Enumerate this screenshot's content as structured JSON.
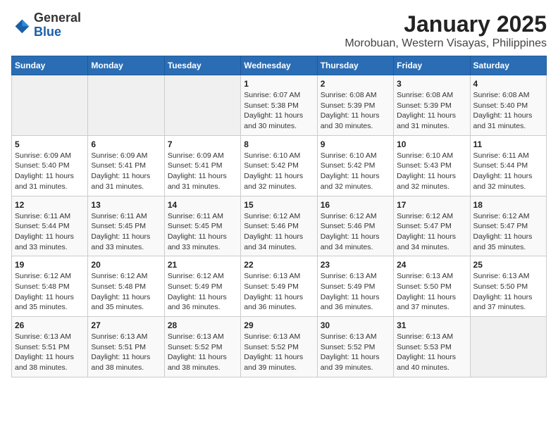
{
  "header": {
    "logo": {
      "line1": "General",
      "line2": "Blue"
    },
    "title": "January 2025",
    "subtitle": "Morobuan, Western Visayas, Philippines"
  },
  "weekdays": [
    "Sunday",
    "Monday",
    "Tuesday",
    "Wednesday",
    "Thursday",
    "Friday",
    "Saturday"
  ],
  "weeks": [
    [
      {
        "day": "",
        "info": ""
      },
      {
        "day": "",
        "info": ""
      },
      {
        "day": "",
        "info": ""
      },
      {
        "day": "1",
        "info": "Sunrise: 6:07 AM\nSunset: 5:38 PM\nDaylight: 11 hours\nand 30 minutes."
      },
      {
        "day": "2",
        "info": "Sunrise: 6:08 AM\nSunset: 5:39 PM\nDaylight: 11 hours\nand 30 minutes."
      },
      {
        "day": "3",
        "info": "Sunrise: 6:08 AM\nSunset: 5:39 PM\nDaylight: 11 hours\nand 31 minutes."
      },
      {
        "day": "4",
        "info": "Sunrise: 6:08 AM\nSunset: 5:40 PM\nDaylight: 11 hours\nand 31 minutes."
      }
    ],
    [
      {
        "day": "5",
        "info": "Sunrise: 6:09 AM\nSunset: 5:40 PM\nDaylight: 11 hours\nand 31 minutes."
      },
      {
        "day": "6",
        "info": "Sunrise: 6:09 AM\nSunset: 5:41 PM\nDaylight: 11 hours\nand 31 minutes."
      },
      {
        "day": "7",
        "info": "Sunrise: 6:09 AM\nSunset: 5:41 PM\nDaylight: 11 hours\nand 31 minutes."
      },
      {
        "day": "8",
        "info": "Sunrise: 6:10 AM\nSunset: 5:42 PM\nDaylight: 11 hours\nand 32 minutes."
      },
      {
        "day": "9",
        "info": "Sunrise: 6:10 AM\nSunset: 5:42 PM\nDaylight: 11 hours\nand 32 minutes."
      },
      {
        "day": "10",
        "info": "Sunrise: 6:10 AM\nSunset: 5:43 PM\nDaylight: 11 hours\nand 32 minutes."
      },
      {
        "day": "11",
        "info": "Sunrise: 6:11 AM\nSunset: 5:44 PM\nDaylight: 11 hours\nand 32 minutes."
      }
    ],
    [
      {
        "day": "12",
        "info": "Sunrise: 6:11 AM\nSunset: 5:44 PM\nDaylight: 11 hours\nand 33 minutes."
      },
      {
        "day": "13",
        "info": "Sunrise: 6:11 AM\nSunset: 5:45 PM\nDaylight: 11 hours\nand 33 minutes."
      },
      {
        "day": "14",
        "info": "Sunrise: 6:11 AM\nSunset: 5:45 PM\nDaylight: 11 hours\nand 33 minutes."
      },
      {
        "day": "15",
        "info": "Sunrise: 6:12 AM\nSunset: 5:46 PM\nDaylight: 11 hours\nand 34 minutes."
      },
      {
        "day": "16",
        "info": "Sunrise: 6:12 AM\nSunset: 5:46 PM\nDaylight: 11 hours\nand 34 minutes."
      },
      {
        "day": "17",
        "info": "Sunrise: 6:12 AM\nSunset: 5:47 PM\nDaylight: 11 hours\nand 34 minutes."
      },
      {
        "day": "18",
        "info": "Sunrise: 6:12 AM\nSunset: 5:47 PM\nDaylight: 11 hours\nand 35 minutes."
      }
    ],
    [
      {
        "day": "19",
        "info": "Sunrise: 6:12 AM\nSunset: 5:48 PM\nDaylight: 11 hours\nand 35 minutes."
      },
      {
        "day": "20",
        "info": "Sunrise: 6:12 AM\nSunset: 5:48 PM\nDaylight: 11 hours\nand 35 minutes."
      },
      {
        "day": "21",
        "info": "Sunrise: 6:12 AM\nSunset: 5:49 PM\nDaylight: 11 hours\nand 36 minutes."
      },
      {
        "day": "22",
        "info": "Sunrise: 6:13 AM\nSunset: 5:49 PM\nDaylight: 11 hours\nand 36 minutes."
      },
      {
        "day": "23",
        "info": "Sunrise: 6:13 AM\nSunset: 5:49 PM\nDaylight: 11 hours\nand 36 minutes."
      },
      {
        "day": "24",
        "info": "Sunrise: 6:13 AM\nSunset: 5:50 PM\nDaylight: 11 hours\nand 37 minutes."
      },
      {
        "day": "25",
        "info": "Sunrise: 6:13 AM\nSunset: 5:50 PM\nDaylight: 11 hours\nand 37 minutes."
      }
    ],
    [
      {
        "day": "26",
        "info": "Sunrise: 6:13 AM\nSunset: 5:51 PM\nDaylight: 11 hours\nand 38 minutes."
      },
      {
        "day": "27",
        "info": "Sunrise: 6:13 AM\nSunset: 5:51 PM\nDaylight: 11 hours\nand 38 minutes."
      },
      {
        "day": "28",
        "info": "Sunrise: 6:13 AM\nSunset: 5:52 PM\nDaylight: 11 hours\nand 38 minutes."
      },
      {
        "day": "29",
        "info": "Sunrise: 6:13 AM\nSunset: 5:52 PM\nDaylight: 11 hours\nand 39 minutes."
      },
      {
        "day": "30",
        "info": "Sunrise: 6:13 AM\nSunset: 5:52 PM\nDaylight: 11 hours\nand 39 minutes."
      },
      {
        "day": "31",
        "info": "Sunrise: 6:13 AM\nSunset: 5:53 PM\nDaylight: 11 hours\nand 40 minutes."
      },
      {
        "day": "",
        "info": ""
      }
    ]
  ]
}
